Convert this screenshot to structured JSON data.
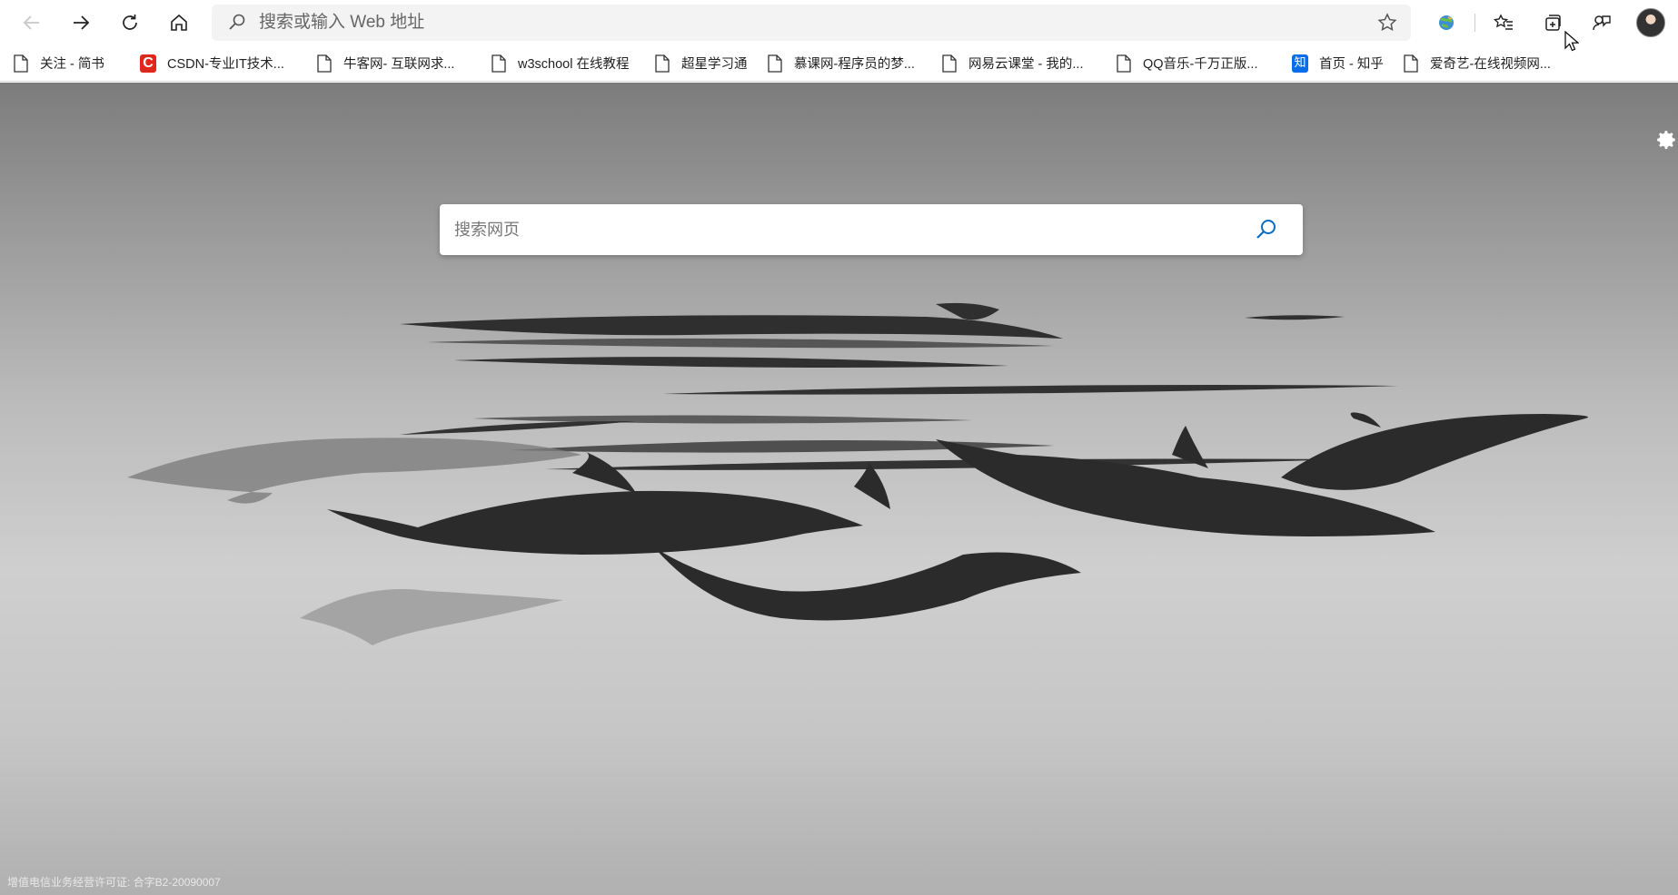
{
  "toolbar": {
    "back_icon": "arrow-left-icon",
    "forward_icon": "arrow-right-icon",
    "refresh_icon": "refresh-icon",
    "home_icon": "home-icon",
    "address_placeholder": "搜索或输入 Web 地址",
    "favorite_icon": "star-icon"
  },
  "extensions": [
    "earth-extension-icon",
    "favorites-list-icon",
    "collections-icon",
    "feedback-icon",
    "profile-avatar"
  ],
  "bookmarks": [
    {
      "label": "关注 - 简书",
      "icon": "page-icon"
    },
    {
      "label": "CSDN-专业IT技术...",
      "icon": "csdn-icon",
      "icon_text": "C"
    },
    {
      "label": "牛客网- 互联网求...",
      "icon": "page-icon"
    },
    {
      "label": "w3school 在线教程",
      "icon": "page-icon"
    },
    {
      "label": "超星学习通",
      "icon": "page-icon"
    },
    {
      "label": "慕课网-程序员的梦...",
      "icon": "page-icon"
    },
    {
      "label": "网易云课堂 - 我的...",
      "icon": "page-icon"
    },
    {
      "label": "QQ音乐-千万正版...",
      "icon": "page-icon"
    },
    {
      "label": "首页 - 知乎",
      "icon": "zhihu-icon",
      "icon_text": "知"
    },
    {
      "label": "爱奇艺-在线视频网...",
      "icon": "page-icon"
    }
  ],
  "newtab": {
    "search_placeholder": "搜索网页",
    "search_button_icon": "search-icon",
    "settings_icon": "gear-icon",
    "license": "增值电信业务经营许可证: 合字B2-20090007"
  }
}
